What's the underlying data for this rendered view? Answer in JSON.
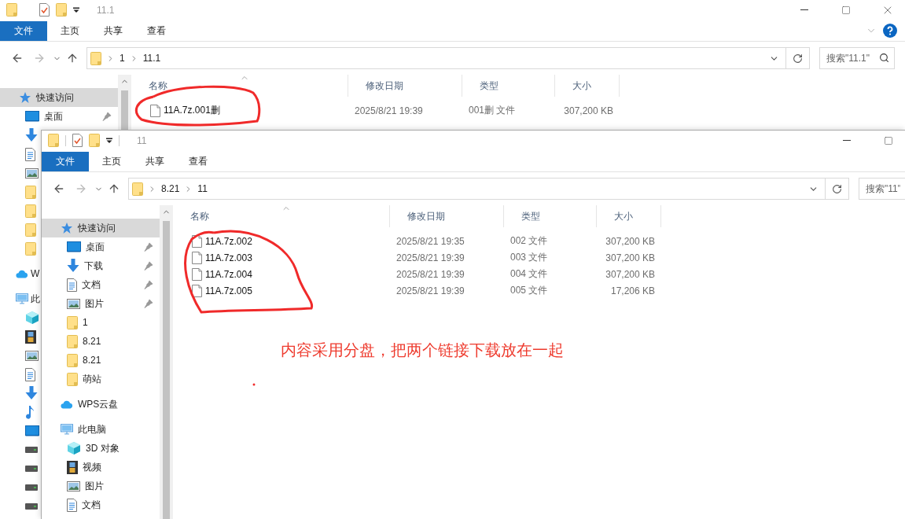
{
  "windows": [
    {
      "title": "11.1",
      "ribbon_tabs": [
        {
          "label": "文件",
          "selected": true
        },
        {
          "label": "主页",
          "selected": false
        },
        {
          "label": "共享",
          "selected": false
        },
        {
          "label": "查看",
          "selected": false
        }
      ],
      "path": [
        "1",
        "11.1"
      ],
      "search": {
        "placeholder": "搜索\"11.1\""
      },
      "nav": [
        {
          "kind": "star",
          "label": "快速访问",
          "selected": true,
          "children": [
            {
              "kind": "desktop",
              "label": "桌面",
              "pinned": true,
              "selected": false
            },
            {
              "kind": "download",
              "selected": false
            },
            {
              "kind": "document",
              "selected": false
            },
            {
              "kind": "picture",
              "selected": false
            },
            {
              "kind": "folder",
              "selected": false
            },
            {
              "kind": "folder",
              "selected": false
            },
            {
              "kind": "folder",
              "selected": false
            },
            {
              "kind": "folder",
              "selected": false
            }
          ]
        },
        {
          "kind": "cloud",
          "label": "W",
          "selected": false
        },
        {
          "kind": "computer",
          "label": "此",
          "selected": false,
          "children": [
            {
              "kind": "cube",
              "selected": false
            },
            {
              "kind": "video",
              "selected": false
            },
            {
              "kind": "picture",
              "selected": false
            },
            {
              "kind": "document",
              "selected": false
            },
            {
              "kind": "download",
              "selected": false
            },
            {
              "kind": "music",
              "selected": false
            },
            {
              "kind": "desktop",
              "selected": false
            },
            {
              "kind": "drive",
              "selected": false
            },
            {
              "kind": "drive",
              "selected": false
            },
            {
              "kind": "drive",
              "selected": false
            },
            {
              "kind": "drive",
              "selected": false
            }
          ]
        }
      ],
      "columns": [
        "名称",
        "修改日期",
        "类型",
        "大小"
      ],
      "files": [
        {
          "name": "11A.7z.001删",
          "modified": "2025/8/21 19:39",
          "type": "001删 文件",
          "size": "307,200 KB"
        }
      ]
    },
    {
      "title": "11",
      "ribbon_tabs": [
        {
          "label": "文件",
          "selected": true
        },
        {
          "label": "主页",
          "selected": false
        },
        {
          "label": "共享",
          "selected": false
        },
        {
          "label": "查看",
          "selected": false
        }
      ],
      "path": [
        "8.21",
        "11"
      ],
      "search": {
        "placeholder": "搜索\"11\""
      },
      "nav": [
        {
          "kind": "star",
          "label": "快速访问",
          "selected": true,
          "children": [
            {
              "kind": "desktop",
              "label": "桌面",
              "pinned": true,
              "selected": false
            },
            {
              "kind": "download",
              "label": "下载",
              "pinned": true,
              "selected": false
            },
            {
              "kind": "document",
              "label": "文档",
              "pinned": true,
              "selected": false
            },
            {
              "kind": "picture",
              "label": "图片",
              "pinned": true,
              "selected": false
            },
            {
              "kind": "folder",
              "label": "1",
              "pinned": false,
              "selected": false
            },
            {
              "kind": "folder",
              "label": "8.21",
              "pinned": false,
              "selected": false
            },
            {
              "kind": "folder",
              "label": "8.21",
              "pinned": false,
              "selected": false
            },
            {
              "kind": "folder",
              "label": "萌站",
              "pinned": false,
              "selected": false
            }
          ]
        },
        {
          "kind": "cloud",
          "label": "WPS云盘",
          "selected": false
        },
        {
          "kind": "computer",
          "label": "此电脑",
          "selected": false,
          "children": [
            {
              "kind": "cube",
              "label": "3D 对象",
              "selected": false
            },
            {
              "kind": "video",
              "label": "视频",
              "selected": false
            },
            {
              "kind": "picture",
              "label": "图片",
              "selected": false
            },
            {
              "kind": "document",
              "label": "文档",
              "selected": false
            }
          ]
        }
      ],
      "columns": [
        "名称",
        "修改日期",
        "类型",
        "大小"
      ],
      "files": [
        {
          "name": "11A.7z.002",
          "modified": "2025/8/21 19:35",
          "type": "002 文件",
          "size": "307,200 KB"
        },
        {
          "name": "11A.7z.003",
          "modified": "2025/8/21 19:39",
          "type": "003 文件",
          "size": "307,200 KB"
        },
        {
          "name": "11A.7z.004",
          "modified": "2025/8/21 19:39",
          "type": "004 文件",
          "size": "307,200 KB"
        },
        {
          "name": "11A.7z.005",
          "modified": "2025/8/21 19:39",
          "type": "005 文件",
          "size": "17,206 KB"
        }
      ]
    }
  ],
  "note": "内容采用分盘，把两个链接下载放在一起"
}
